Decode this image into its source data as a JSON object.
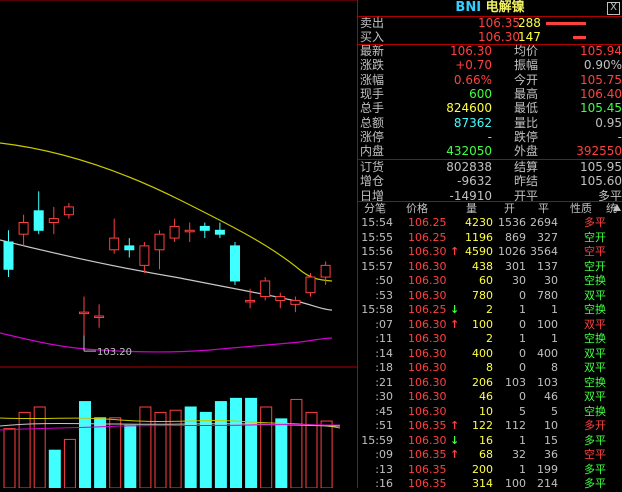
{
  "title": {
    "code": "BNI",
    "name": "电解镍"
  },
  "close_label": "X",
  "order_book": [
    {
      "label": "卖出",
      "price": "106.35",
      "vol": "288",
      "bar_frac": 1.0
    },
    {
      "label": "买入",
      "price": "106.30",
      "vol": "147",
      "bar_frac": 0.33
    }
  ],
  "stats": [
    {
      "l1": "最新",
      "v1": "106.30",
      "c1": "r",
      "l2": "均价",
      "v2": "105.94",
      "c2": "r"
    },
    {
      "l1": "涨跌",
      "v1": "+0.70",
      "c1": "r",
      "l2": "振幅",
      "v2": "0.90%",
      "c2": "w"
    },
    {
      "l1": "涨幅",
      "v1": "0.66%",
      "c1": "r",
      "l2": "今开",
      "v2": "105.75",
      "c2": "r"
    },
    {
      "l1": "现手",
      "v1": "600",
      "c1": "g",
      "l2": "最高",
      "v2": "106.40",
      "c2": "r"
    },
    {
      "l1": "总手",
      "v1": "824600",
      "c1": "y",
      "l2": "最低",
      "v2": "105.45",
      "c2": "g"
    },
    {
      "l1": "总额",
      "v1": "87362",
      "c1": "c",
      "l2": "量比",
      "v2": "0.95",
      "c2": "w"
    },
    {
      "l1": "涨停",
      "v1": "-",
      "c1": "w",
      "l2": "跌停",
      "v2": "-",
      "c2": "w"
    },
    {
      "l1": "内盘",
      "v1": "432050",
      "c1": "g",
      "l2": "外盘",
      "v2": "392550",
      "c2": "r"
    }
  ],
  "stats2": [
    {
      "l1": "订货",
      "v1": "802838",
      "c1": "w",
      "l2": "结算",
      "v2": "105.95",
      "c2": "w"
    },
    {
      "l1": "增仓",
      "v1": "-9632",
      "c1": "w",
      "l2": "昨结",
      "v2": "105.60",
      "c2": "w"
    },
    {
      "l1": "日增",
      "v1": "-14910",
      "c1": "w",
      "l2": "开平",
      "v2": "多平",
      "c2": "w"
    }
  ],
  "tick_header": [
    "分笔",
    "价格",
    "量",
    "开",
    "平",
    "性质",
    "统"
  ],
  "ticks": [
    {
      "t": "15:54",
      "p": "106.25",
      "a": "",
      "v": "4230",
      "o": "1536",
      "c": "2694",
      "n": "多平",
      "pc": "r",
      "nc": "r"
    },
    {
      "t": "15:55",
      "p": "106.25",
      "a": "",
      "v": "1196",
      "o": "869",
      "c": "327",
      "n": "空开",
      "pc": "r",
      "nc": "g"
    },
    {
      "t": "15:56",
      "p": "106.30",
      "a": "up",
      "v": "4590",
      "o": "1026",
      "c": "3564",
      "n": "空平",
      "pc": "r",
      "nc": "r"
    },
    {
      "t": "15:57",
      "p": "106.30",
      "a": "",
      "v": "438",
      "o": "301",
      "c": "137",
      "n": "空开",
      "pc": "r",
      "nc": "g"
    },
    {
      "t": ":50",
      "p": "106.30",
      "a": "",
      "v": "60",
      "o": "30",
      "c": "30",
      "n": "空换",
      "pc": "r",
      "nc": "g"
    },
    {
      "t": ":53",
      "p": "106.30",
      "a": "",
      "v": "780",
      "o": "0",
      "c": "780",
      "n": "双平",
      "pc": "r",
      "nc": "g"
    },
    {
      "t": "15:58",
      "p": "106.25",
      "a": "down",
      "v": "2",
      "o": "1",
      "c": "1",
      "n": "空换",
      "pc": "r",
      "nc": "g"
    },
    {
      "t": ":07",
      "p": "106.30",
      "a": "up",
      "v": "100",
      "o": "0",
      "c": "100",
      "n": "双平",
      "pc": "r",
      "nc": "r"
    },
    {
      "t": ":11",
      "p": "106.30",
      "a": "",
      "v": "2",
      "o": "1",
      "c": "1",
      "n": "空换",
      "pc": "r",
      "nc": "g"
    },
    {
      "t": ":14",
      "p": "106.30",
      "a": "",
      "v": "400",
      "o": "0",
      "c": "400",
      "n": "双平",
      "pc": "r",
      "nc": "g"
    },
    {
      "t": ":18",
      "p": "106.30",
      "a": "",
      "v": "8",
      "o": "0",
      "c": "8",
      "n": "双平",
      "pc": "r",
      "nc": "g"
    },
    {
      "t": ":21",
      "p": "106.30",
      "a": "",
      "v": "206",
      "o": "103",
      "c": "103",
      "n": "空换",
      "pc": "r",
      "nc": "g"
    },
    {
      "t": ":30",
      "p": "106.30",
      "a": "",
      "v": "46",
      "o": "0",
      "c": "46",
      "n": "双平",
      "pc": "r",
      "nc": "g"
    },
    {
      "t": ":45",
      "p": "106.30",
      "a": "",
      "v": "10",
      "o": "5",
      "c": "5",
      "n": "空换",
      "pc": "r",
      "nc": "g"
    },
    {
      "t": ":51",
      "p": "106.35",
      "a": "up",
      "v": "122",
      "o": "112",
      "c": "10",
      "n": "多开",
      "pc": "r",
      "nc": "r"
    },
    {
      "t": "15:59",
      "p": "106.30",
      "a": "down",
      "v": "16",
      "o": "1",
      "c": "15",
      "n": "多平",
      "pc": "r",
      "nc": "g"
    },
    {
      "t": ":09",
      "p": "106.35",
      "a": "up",
      "v": "68",
      "o": "32",
      "c": "36",
      "n": "空平",
      "pc": "r",
      "nc": "r"
    },
    {
      "t": ":13",
      "p": "106.35",
      "a": "",
      "v": "200",
      "o": "1",
      "c": "199",
      "n": "多平",
      "pc": "r",
      "nc": "g"
    },
    {
      "t": ":16",
      "p": "106.35",
      "a": "",
      "v": "314",
      "o": "100",
      "c": "214",
      "n": "多平",
      "pc": "r",
      "nc": "g"
    }
  ],
  "chart_data": {
    "type": "candlestick",
    "low_annotation": "103.20",
    "candles": [
      {
        "o": 104.45,
        "c": 104.1,
        "h": 104.6,
        "l": 104.0
      },
      {
        "o": 104.55,
        "c": 104.7,
        "h": 104.8,
        "l": 104.4
      },
      {
        "o": 104.85,
        "c": 104.6,
        "h": 105.1,
        "l": 104.55
      },
      {
        "o": 104.7,
        "c": 104.75,
        "h": 104.9,
        "l": 104.55
      },
      {
        "o": 104.8,
        "c": 104.9,
        "h": 104.95,
        "l": 104.75
      },
      {
        "o": 103.55,
        "c": 103.55,
        "h": 103.75,
        "l": 103.25
      },
      {
        "o": 103.5,
        "c": 103.5,
        "h": 103.65,
        "l": 103.35
      },
      {
        "o": 104.35,
        "c": 104.5,
        "h": 104.75,
        "l": 104.3
      },
      {
        "o": 104.4,
        "c": 104.35,
        "h": 104.5,
        "l": 104.25
      },
      {
        "o": 104.15,
        "c": 104.4,
        "h": 104.45,
        "l": 104.05
      },
      {
        "o": 104.35,
        "c": 104.55,
        "h": 104.6,
        "l": 104.1
      },
      {
        "o": 104.5,
        "c": 104.65,
        "h": 104.75,
        "l": 104.45
      },
      {
        "o": 104.6,
        "c": 104.6,
        "h": 104.7,
        "l": 104.45
      },
      {
        "o": 104.65,
        "c": 104.6,
        "h": 104.7,
        "l": 104.5
      },
      {
        "o": 104.6,
        "c": 104.55,
        "h": 104.7,
        "l": 104.5
      },
      {
        "o": 104.4,
        "c": 103.95,
        "h": 104.45,
        "l": 103.9
      },
      {
        "o": 103.7,
        "c": 103.7,
        "h": 103.85,
        "l": 103.6
      },
      {
        "o": 103.75,
        "c": 103.95,
        "h": 104.0,
        "l": 103.7
      },
      {
        "o": 103.7,
        "c": 103.75,
        "h": 103.8,
        "l": 103.6
      },
      {
        "o": 103.65,
        "c": 103.7,
        "h": 103.75,
        "l": 103.55
      },
      {
        "o": 103.8,
        "c": 104.0,
        "h": 104.05,
        "l": 103.75
      },
      {
        "o": 104.0,
        "c": 104.15,
        "h": 104.2,
        "l": 103.9
      }
    ],
    "volumes": [
      0.55,
      0.7,
      0.75,
      0.35,
      0.45,
      0.8,
      0.65,
      0.65,
      0.58,
      0.75,
      0.7,
      0.72,
      0.75,
      0.7,
      0.8,
      0.83,
      0.83,
      0.75,
      0.64,
      0.82,
      0.7,
      0.62
    ],
    "vol_colors": [
      "r",
      "r",
      "r",
      "c",
      "r",
      "c",
      "c",
      "r",
      "c",
      "r",
      "r",
      "r",
      "c",
      "c",
      "c",
      "c",
      "c",
      "r",
      "c",
      "r",
      "r",
      "r"
    ]
  }
}
